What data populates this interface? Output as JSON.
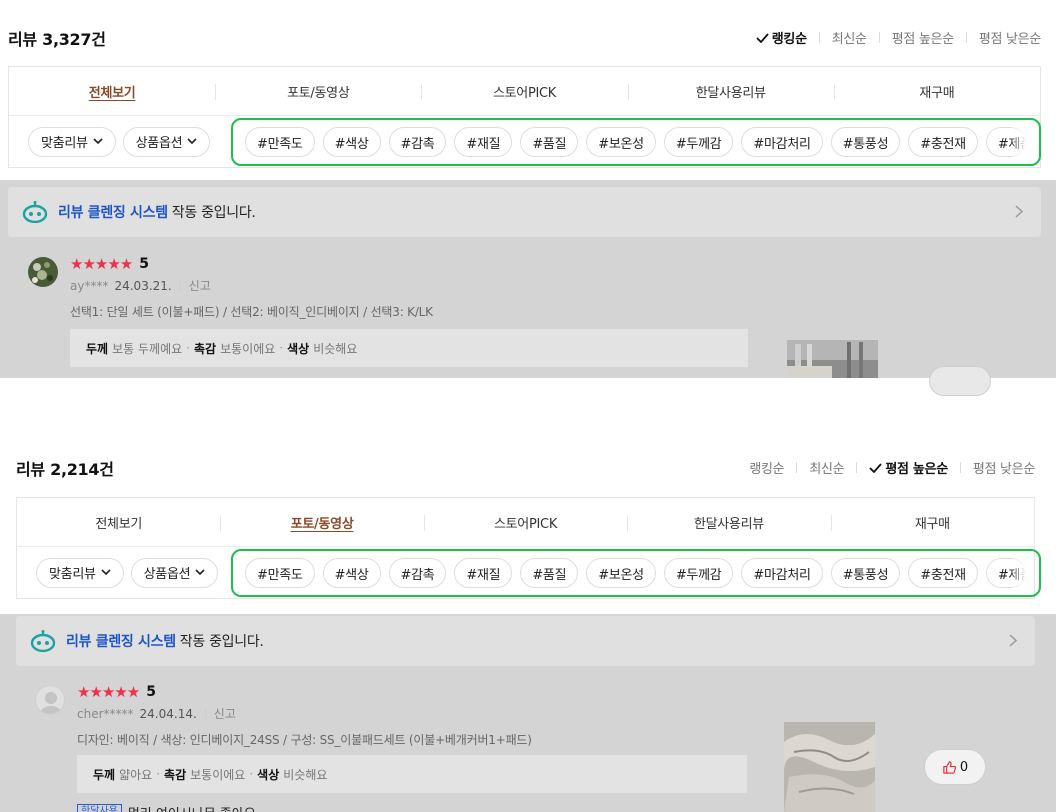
{
  "panel1": {
    "review_count_label": "리뷰 3,327건",
    "sort_options": [
      "랭킹순",
      "최신순",
      "평점 높은순",
      "평점 낮은순"
    ],
    "active_sort": "랭킹순",
    "tabs": [
      "전체보기",
      "포토/동영상",
      "스토어PICK",
      "한달사용리뷰",
      "재구매"
    ],
    "active_tab": "전체보기",
    "filter_buttons": [
      "맞춤리뷰",
      "상품옵션"
    ],
    "tags": [
      "#만족도",
      "#색상",
      "#감촉",
      "#재질",
      "#품질",
      "#보온성",
      "#두께감",
      "#마감처리",
      "#통풍성",
      "#충전재",
      "#제품"
    ],
    "cleansing": {
      "highlight": "리뷰 클렌징 시스템",
      "rest": "작동 중입니다."
    },
    "review": {
      "stars": "★★★★★",
      "score": "5",
      "user": "ay****",
      "date": "24.03.21.",
      "report": "신고",
      "option": "선택1: 단일 세트 (이불+패드) / 선택2: 베이직_인디베이지 / 선택3: K/LK",
      "eval": [
        {
          "key": "두께",
          "val": "보통 두께예요"
        },
        {
          "key": "촉감",
          "val": "보통이에요"
        },
        {
          "key": "색상",
          "val": "비슷해요"
        }
      ]
    }
  },
  "panel2": {
    "review_count_label": "리뷰 2,214건",
    "sort_options": [
      "랭킹순",
      "최신순",
      "평점 높은순",
      "평점 낮은순"
    ],
    "active_sort": "평점 높은순",
    "tabs": [
      "전체보기",
      "포토/동영상",
      "스토어PICK",
      "한달사용리뷰",
      "재구매"
    ],
    "active_tab": "포토/동영상",
    "filter_buttons": [
      "맞춤리뷰",
      "상품옵션"
    ],
    "tags": [
      "#만족도",
      "#색상",
      "#감촉",
      "#재질",
      "#품질",
      "#보온성",
      "#두께감",
      "#마감처리",
      "#통풍성",
      "#충전재",
      "#제품"
    ],
    "cleansing": {
      "highlight": "리뷰 클렌징 시스템",
      "rest": "작동 중입니다."
    },
    "review": {
      "stars": "★★★★★",
      "score": "5",
      "user": "cher*****",
      "date": "24.04.14.",
      "report": "신고",
      "option": "디자인: 베이직 / 색상: 인디베이지_24SS / 구성: SS_이불패드세트 (이불+베개커버1+패드)",
      "eval": [
        {
          "key": "두께",
          "val": "얇아요"
        },
        {
          "key": "촉감",
          "val": "보통이에요"
        },
        {
          "key": "색상",
          "val": "비슷해요"
        }
      ],
      "like_count": "0",
      "badge": "한달사용",
      "body": "멀리 여이시나무 좋아요"
    }
  },
  "colors": {
    "brown_active_tab": "#8a4a26",
    "green_highlight": "#1fbf49",
    "star_red": "#f0304a",
    "link_blue": "#1d56c7"
  }
}
